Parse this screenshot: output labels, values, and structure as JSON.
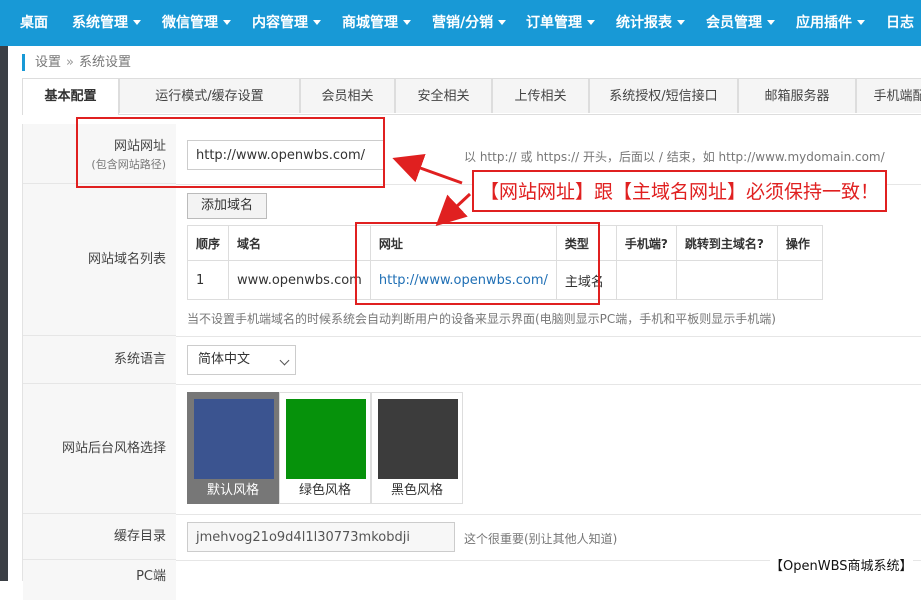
{
  "nav": {
    "items": [
      {
        "label": "桌面",
        "caret": false
      },
      {
        "label": "系统管理",
        "caret": true
      },
      {
        "label": "微信管理",
        "caret": true
      },
      {
        "label": "内容管理",
        "caret": true
      },
      {
        "label": "商城管理",
        "caret": true
      },
      {
        "label": "营销/分销",
        "caret": true
      },
      {
        "label": "订单管理",
        "caret": true
      },
      {
        "label": "统计报表",
        "caret": true
      },
      {
        "label": "会员管理",
        "caret": true
      },
      {
        "label": "应用插件",
        "caret": true
      },
      {
        "label": "日志",
        "caret": false
      }
    ]
  },
  "breadcrumb": {
    "parent": "设置",
    "separator": "»",
    "current": "系统设置"
  },
  "tabs": [
    {
      "label": "基本配置",
      "active": true
    },
    {
      "label": "运行模式/缓存设置"
    },
    {
      "label": "会员相关"
    },
    {
      "label": "安全相关"
    },
    {
      "label": "上传相关"
    },
    {
      "label": "系统授权/短信接口"
    },
    {
      "label": "邮箱服务器"
    },
    {
      "label": "手机端配置"
    }
  ],
  "form": {
    "site_url": {
      "label": "网站网址",
      "sublabel": "(包含网站路径)",
      "value": "http://www.openwbs.com/",
      "hint": "以 http:// 或 https:// 开头，后面以 / 结束，如 http://www.mydomain.com/"
    },
    "domain_list": {
      "label": "网站域名列表",
      "add_button": "添加域名",
      "columns": [
        "顺序",
        "域名",
        "网址",
        "类型",
        "手机端?",
        "跳转到主域名?",
        "操作"
      ],
      "rows": [
        {
          "order": "1",
          "domain": "www.openwbs.com",
          "url": "http://www.openwbs.com/",
          "type": "主域名",
          "mobile": "",
          "redirect": "",
          "action": ""
        }
      ],
      "note": "当不设置手机端域名的时候系统会自动判断用户的设备来显示界面(电脑则显示PC端，手机和平板则显示手机端)"
    },
    "language": {
      "label": "系统语言",
      "selected": "简体中文"
    },
    "theme": {
      "label": "网站后台风格选择",
      "options": [
        {
          "name": "默认风格",
          "color": "#3b5490",
          "selected": true
        },
        {
          "name": "绿色风格",
          "color": "#06920b"
        },
        {
          "name": "黑色风格",
          "color": "#3c3c3c"
        }
      ]
    },
    "cache_dir": {
      "label": "缓存目录",
      "value": "jmehvog21o9d4l1l30773mkobdji",
      "hint": "这个很重要(别让其他人知道)"
    },
    "pc_label": "PC端"
  },
  "annotation": {
    "callout_text": "【网站网址】跟【主域名网址】必须保持一致！",
    "color": "#e02020"
  },
  "watermark": "【OpenWBS商城系统】",
  "colors": {
    "nav_bg": "#1899d6",
    "accent": "#1899d6"
  }
}
